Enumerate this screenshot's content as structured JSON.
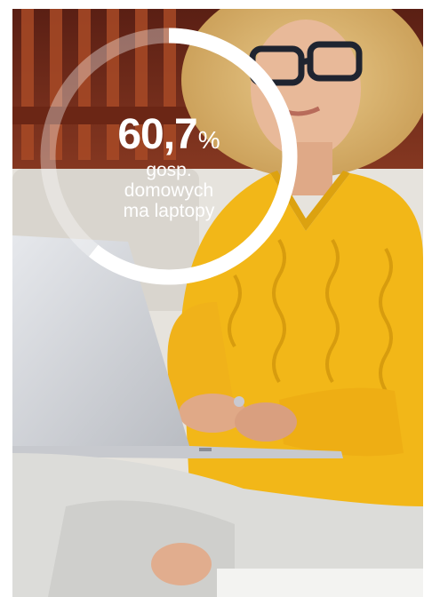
{
  "stat": {
    "value": "60,7",
    "unit": "%",
    "caption_lines": [
      "gosp.",
      "domowych",
      "ma laptopy"
    ],
    "fraction": 0.607
  },
  "photo": {
    "subject": "woman-with-laptop-on-sofa"
  },
  "colors": {
    "ring_fill": "#ffffff",
    "ring_track": "rgba(255,255,255,0.35)",
    "sweater": "#f2b718",
    "sofa": "#e3e0da",
    "laptop": "#d4d6da",
    "wall": "#7a2e1e"
  }
}
